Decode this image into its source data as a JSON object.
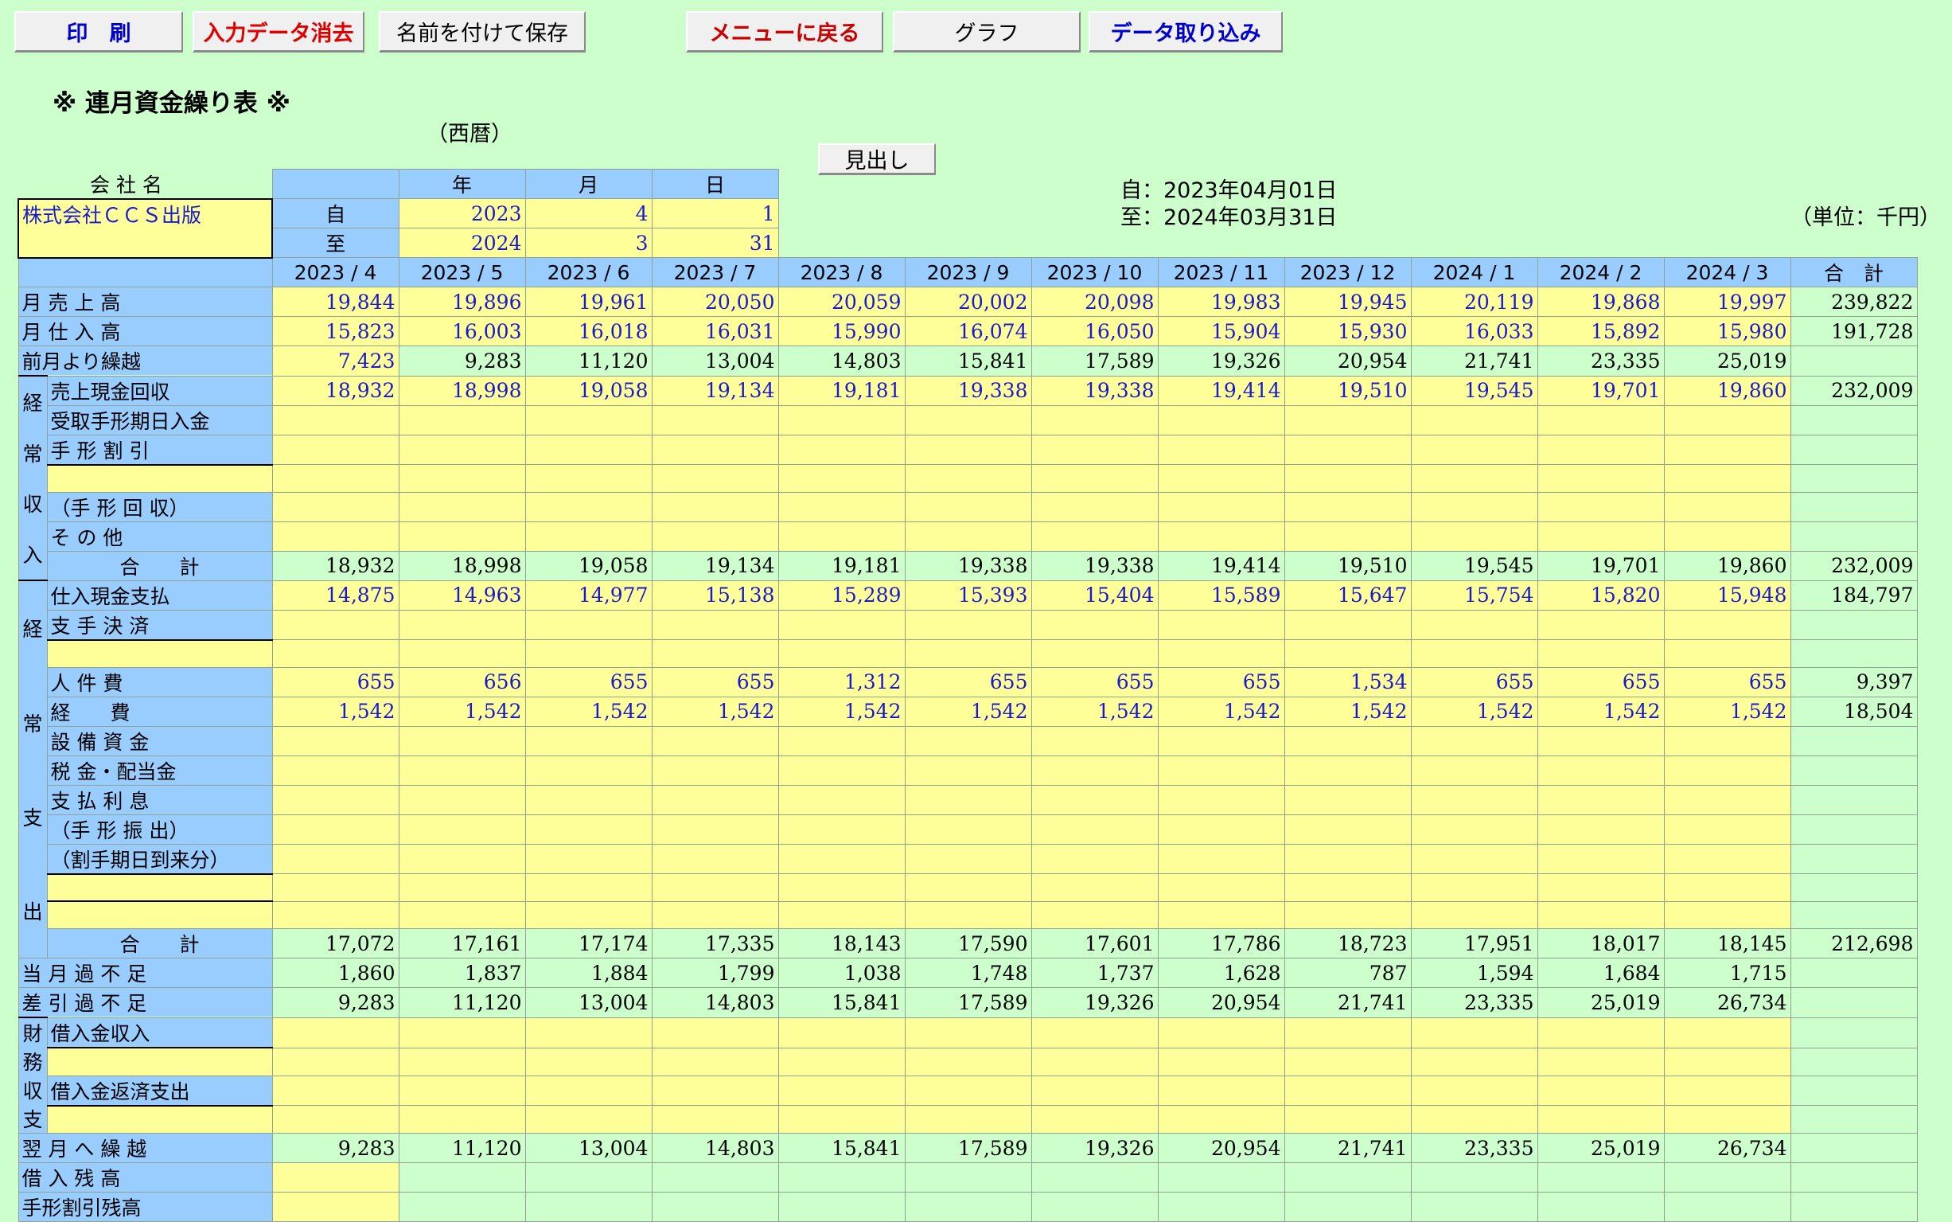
{
  "toolbar": [
    {
      "label": "印　刷",
      "color": "#0000cc"
    },
    {
      "label": "入力データ消去",
      "color": "#e00000"
    },
    {
      "label": "名前を付けて保存",
      "color": "#000000"
    },
    {
      "label": "メニューに戻る",
      "color": "#cc0000"
    },
    {
      "label": "グラフ",
      "color": "#000000"
    },
    {
      "label": "データ取り込み",
      "color": "#0000cc"
    }
  ],
  "title": "※ 連月資金繰り表 ※",
  "era_label": "（西暦）",
  "header_button": "見出し",
  "company_label": "会 社 名",
  "company_name": "株式会社ＣＣＳ出版",
  "period": {
    "col_year": "年",
    "col_month": "月",
    "col_day": "日",
    "from_label": "自",
    "to_label": "至",
    "from": {
      "year": "2023",
      "month": "4",
      "day": "1"
    },
    "to": {
      "year": "2024",
      "month": "3",
      "day": "31"
    },
    "from_text": "自：2023年04月01日",
    "to_text": "至：2024年03月31日",
    "unit": "（単位：千円）"
  },
  "months": [
    "2023 / 4",
    "2023 / 5",
    "2023 / 6",
    "2023 / 7",
    "2023 / 8",
    "2023 / 9",
    "2023 / 10",
    "2023 / 11",
    "2023 / 12",
    "2024 / 1",
    "2024 / 2",
    "2024 / 3"
  ],
  "total_header": "合　計",
  "sections": {
    "income": [
      "経",
      "常",
      "収",
      "入"
    ],
    "expense": [
      "経",
      "常",
      "支",
      "出"
    ],
    "finance": [
      "財",
      "務",
      "収",
      "支"
    ]
  },
  "rows": [
    {
      "id": "sales",
      "label": "月 売 上 高",
      "indent": "L",
      "kind": "inp",
      "values": [
        "19,844",
        "19,896",
        "19,961",
        "20,050",
        "20,059",
        "20,002",
        "20,098",
        "19,983",
        "19,945",
        "20,119",
        "19,868",
        "19,997"
      ],
      "total": "239,822"
    },
    {
      "id": "purchase",
      "label": "月 仕 入 高",
      "indent": "L",
      "kind": "inp",
      "values": [
        "15,823",
        "16,003",
        "16,018",
        "16,031",
        "15,990",
        "16,074",
        "16,050",
        "15,904",
        "15,930",
        "16,033",
        "15,892",
        "15,980"
      ],
      "total": "191,728"
    },
    {
      "id": "carry",
      "label": "前月より繰越",
      "indent": "L",
      "kind": "mix",
      "values": [
        "7,423",
        "9,283",
        "11,120",
        "13,004",
        "14,803",
        "15,841",
        "17,589",
        "19,326",
        "20,954",
        "21,741",
        "23,335",
        "25,019"
      ],
      "total": ""
    },
    {
      "id": "cash_recv",
      "sect": "income",
      "label": "売上現金回収",
      "kind": "inp",
      "values": [
        "18,932",
        "18,998",
        "19,058",
        "19,134",
        "19,181",
        "19,338",
        "19,338",
        "19,414",
        "19,510",
        "19,545",
        "19,701",
        "19,860"
      ],
      "total": "232,009"
    },
    {
      "id": "bill_due",
      "sect": "income",
      "label": "受取手形期日入金",
      "kind": "inpE",
      "values": [],
      "total": ""
    },
    {
      "id": "bill_disc",
      "sect": "income",
      "label": "手 形 割 引",
      "kind": "inpE",
      "values": [],
      "total": ""
    },
    {
      "id": "inc_blank",
      "sect": "income",
      "label": "",
      "kind": "inpE",
      "values": [],
      "total": ""
    },
    {
      "id": "bill_collect",
      "sect": "income",
      "label": "（手 形 回 収）",
      "kind": "inpE",
      "values": [],
      "total": ""
    },
    {
      "id": "inc_other",
      "sect": "income",
      "label": "そ の 他",
      "kind": "inpE",
      "values": [],
      "total": ""
    },
    {
      "id": "inc_total",
      "sect": "income",
      "label": "合　　計",
      "center": true,
      "kind": "calc",
      "values": [
        "18,932",
        "18,998",
        "19,058",
        "19,134",
        "19,181",
        "19,338",
        "19,338",
        "19,414",
        "19,510",
        "19,545",
        "19,701",
        "19,860"
      ],
      "total": "232,009"
    },
    {
      "id": "pay_cash",
      "sect": "expense",
      "label": "仕入現金支払",
      "kind": "inp",
      "values": [
        "14,875",
        "14,963",
        "14,977",
        "15,138",
        "15,289",
        "15,393",
        "15,404",
        "15,589",
        "15,647",
        "15,754",
        "15,820",
        "15,948"
      ],
      "total": "184,797"
    },
    {
      "id": "pay_bill",
      "sect": "expense",
      "label": "支 手 決 済",
      "kind": "inpE",
      "values": [],
      "total": ""
    },
    {
      "id": "exp_blank1",
      "sect": "expense",
      "label": "",
      "kind": "inpE",
      "values": [],
      "total": ""
    },
    {
      "id": "personnel",
      "sect": "expense",
      "label": "人 件 費",
      "kind": "inp",
      "values": [
        "655",
        "656",
        "655",
        "655",
        "1,312",
        "655",
        "655",
        "655",
        "1,534",
        "655",
        "655",
        "655"
      ],
      "total": "9,397"
    },
    {
      "id": "expenses",
      "sect": "expense",
      "label": "経　　費",
      "kind": "inp",
      "values": [
        "1,542",
        "1,542",
        "1,542",
        "1,542",
        "1,542",
        "1,542",
        "1,542",
        "1,542",
        "1,542",
        "1,542",
        "1,542",
        "1,542"
      ],
      "total": "18,504"
    },
    {
      "id": "capex",
      "sect": "expense",
      "label": "設 備 資 金",
      "kind": "inpE",
      "values": [],
      "total": ""
    },
    {
      "id": "tax",
      "sect": "expense",
      "label": "税 金・配当金",
      "kind": "inpE",
      "values": [],
      "total": ""
    },
    {
      "id": "interest",
      "sect": "expense",
      "label": "支 払 利 息",
      "kind": "inpE",
      "values": [],
      "total": ""
    },
    {
      "id": "bill_issue",
      "sect": "expense",
      "label": "（手 形 振 出）",
      "kind": "inpE",
      "values": [],
      "total": ""
    },
    {
      "id": "disc_due",
      "sect": "expense",
      "label": "（割手期日到来分）",
      "kind": "inpE",
      "values": [],
      "total": ""
    },
    {
      "id": "exp_blank2",
      "sect": "expense",
      "label": "",
      "kind": "inpE",
      "values": [],
      "total": ""
    },
    {
      "id": "exp_blank3",
      "sect": "expense",
      "label": "",
      "kind": "inpE",
      "values": [],
      "total": ""
    },
    {
      "id": "exp_total",
      "sect": "expense",
      "label": "合　　計",
      "center": true,
      "kind": "calc",
      "values": [
        "17,072",
        "17,161",
        "17,174",
        "17,335",
        "18,143",
        "17,590",
        "17,601",
        "17,786",
        "18,723",
        "17,951",
        "18,017",
        "18,145"
      ],
      "total": "212,698"
    },
    {
      "id": "month_diff",
      "label": "当 月 過 不 足",
      "indent": "L",
      "kind": "calc",
      "values": [
        "1,860",
        "1,837",
        "1,884",
        "1,799",
        "1,038",
        "1,748",
        "1,737",
        "1,628",
        "787",
        "1,594",
        "1,684",
        "1,715"
      ],
      "total": ""
    },
    {
      "id": "net_diff",
      "label": "差 引 過 不 足",
      "indent": "L",
      "kind": "calc",
      "values": [
        "9,283",
        "11,120",
        "13,004",
        "14,803",
        "15,841",
        "17,589",
        "19,326",
        "20,954",
        "21,741",
        "23,335",
        "25,019",
        "26,734"
      ],
      "total": ""
    },
    {
      "id": "loan_in",
      "sect": "finance",
      "label": "借入金収入",
      "kind": "inpE",
      "values": [],
      "total": ""
    },
    {
      "id": "fin_blank1",
      "sect": "finance",
      "label": "",
      "kind": "inpE",
      "values": [],
      "total": ""
    },
    {
      "id": "loan_out",
      "sect": "finance",
      "label": "借入金返済支出",
      "kind": "inpE",
      "values": [],
      "total": ""
    },
    {
      "id": "fin_blank2",
      "sect": "finance",
      "label": "",
      "kind": "inpE",
      "values": [],
      "total": ""
    },
    {
      "id": "next_carry",
      "label": "翌 月 へ 繰 越",
      "indent": "L",
      "kind": "calc",
      "values": [
        "9,283",
        "11,120",
        "13,004",
        "14,803",
        "15,841",
        "17,589",
        "19,326",
        "20,954",
        "21,741",
        "23,335",
        "25,019",
        "26,734"
      ],
      "total": ""
    },
    {
      "id": "loan_bal",
      "label": "借 入 残 高",
      "indent": "L",
      "kind": "bal",
      "values": [],
      "total": ""
    },
    {
      "id": "disc_bal",
      "label": "手形割引残高",
      "indent": "L",
      "kind": "bal",
      "values": [],
      "total": ""
    }
  ]
}
